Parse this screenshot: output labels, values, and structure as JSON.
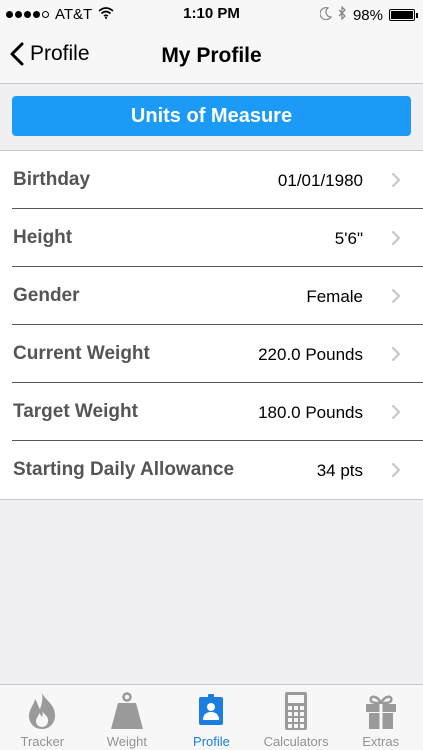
{
  "status_bar": {
    "carrier": "AT&T",
    "time": "1:10 PM",
    "battery": "98%",
    "battery_level": 0.98
  },
  "nav": {
    "back_label": "Profile",
    "title": "My Profile"
  },
  "units_button": {
    "label": "Units of Measure"
  },
  "profile_rows": [
    {
      "label": "Birthday",
      "value": "01/01/1980"
    },
    {
      "label": "Height",
      "value": "5'6\""
    },
    {
      "label": "Gender",
      "value": "Female"
    },
    {
      "label": "Current Weight",
      "value": "220.0 Pounds"
    },
    {
      "label": "Target Weight",
      "value": "180.0 Pounds"
    },
    {
      "label": "Starting Daily Allowance",
      "value": "34 pts"
    }
  ],
  "tabs": [
    {
      "label": "Tracker",
      "icon": "flame-icon",
      "active": false
    },
    {
      "label": "Weight",
      "icon": "weight-icon",
      "active": false
    },
    {
      "label": "Profile",
      "icon": "profile-card-icon",
      "active": true
    },
    {
      "label": "Calculators",
      "icon": "calculator-icon",
      "active": false
    },
    {
      "label": "Extras",
      "icon": "gift-icon",
      "active": false
    }
  ],
  "colors": {
    "accent": "#1b9af7",
    "tab_active": "#1b7ee0",
    "tab_inactive": "#929292"
  }
}
